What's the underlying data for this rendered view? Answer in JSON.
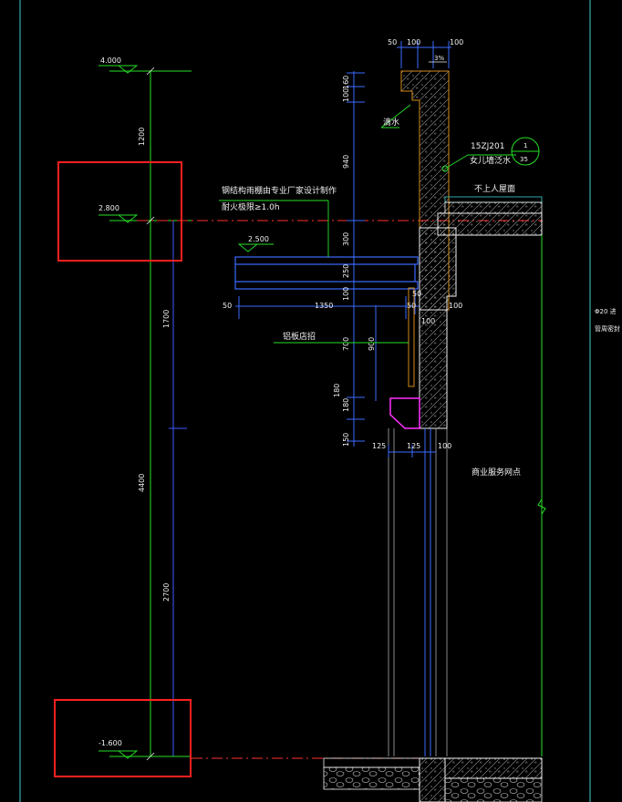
{
  "drawing": {
    "elevations": {
      "top": "4.000",
      "upper": "2.800",
      "mid": "2.500",
      "bottom": "-1.600"
    },
    "dimensions": {
      "top_50": "50",
      "top_100a": "100",
      "top_100b": "100",
      "slope": "3%",
      "v_1200": "1200",
      "v_1700": "1700",
      "v_4400": "4400",
      "v_2700": "2700",
      "r_100": "100",
      "r_160": "160",
      "r_940": "940",
      "r_300": "300",
      "r_250": "250",
      "r_100b": "100",
      "r_700": "700",
      "r_180a": "180",
      "r_180b": "180",
      "r_150": "150",
      "r_900": "900",
      "h_50": "50",
      "h_1350": "1350",
      "w_50a": "50",
      "w_50b": "50",
      "w_100a": "100",
      "w_100b": "100",
      "b_125a": "125",
      "b_125b": "125",
      "b_100": "100"
    },
    "labels": {
      "drip": "滴水",
      "ref_code": "15ZJ201",
      "parapet": "女儿墙泛水",
      "detail_no": "1",
      "detail_sheet": "35",
      "roof": "不上人屋面",
      "canopy_line1": "钢结构雨棚由专业厂家设计制作",
      "canopy_line2": "耐火极限≥1.0h",
      "sign": "铝板店招",
      "shop": "商业服务网点",
      "edge_line1": "Φ20 进",
      "edge_line2": "管周密封"
    }
  }
}
